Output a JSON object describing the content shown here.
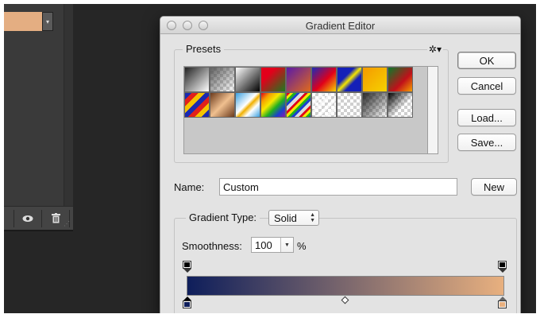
{
  "dialog": {
    "title": "Gradient Editor",
    "presets_label": "Presets",
    "gear_icon": "gear-icon",
    "buttons": {
      "ok": "OK",
      "cancel": "Cancel",
      "load": "Load...",
      "save": "Save...",
      "new": "New"
    },
    "name_label": "Name:",
    "name_value": "Custom",
    "gradient_type_label": "Gradient Type:",
    "gradient_type_value": "Solid",
    "smoothness_label": "Smoothness:",
    "smoothness_value": "100",
    "smoothness_unit": "%",
    "gradient": {
      "color_start": "#0e1e5b",
      "color_end": "#e8b07f",
      "opacity_stop_color": "#000000",
      "midpoint_percent": 50
    }
  },
  "colors": {
    "left_swatch": "#e4ae82"
  },
  "left_panel": {
    "footer_icons": [
      "eye-icon",
      "trash-icon"
    ]
  }
}
